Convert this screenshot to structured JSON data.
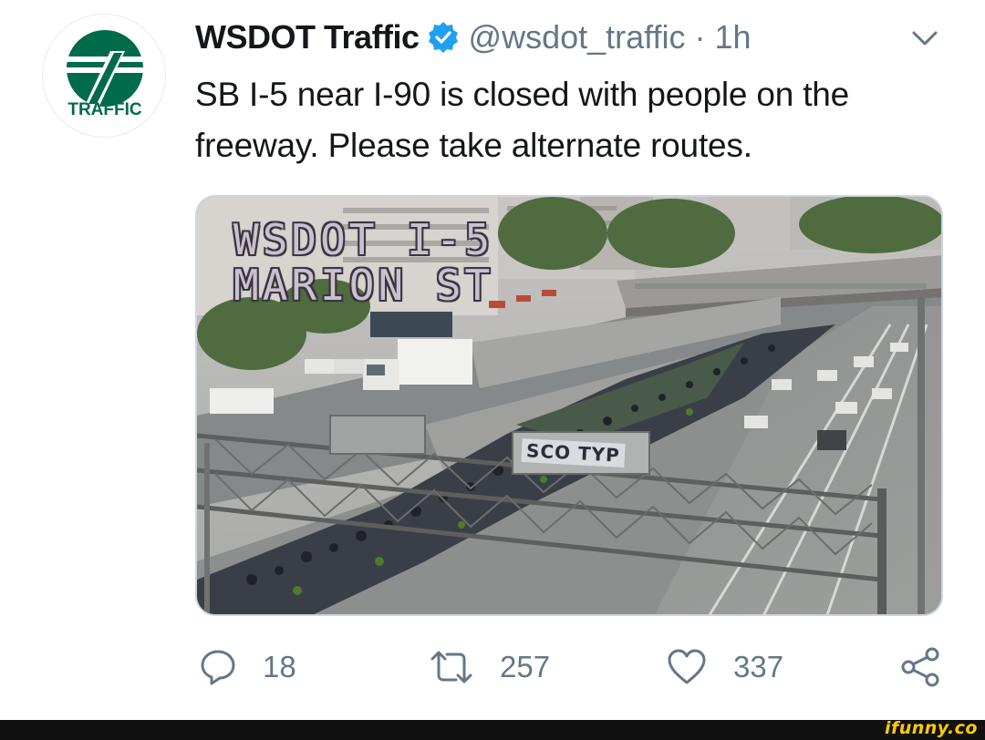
{
  "tweet": {
    "avatar_label": "TRAFFIC",
    "display_name": "WSDOT Traffic",
    "handle": "@wsdot_traffic",
    "separator": "·",
    "time": "1h",
    "text": "SB I-5 near I-90 is closed with people on the freeway. Please take alternate routes."
  },
  "media": {
    "camera_label_line1": "WSDOT I-5",
    "camera_label_line2": "MARION ST",
    "sign_text": "SCO TYP"
  },
  "actions": {
    "reply_count": "18",
    "retweet_count": "257",
    "like_count": "337"
  },
  "footer": {
    "watermark": "ifunny.co"
  },
  "colors": {
    "brand_green": "#006b4a",
    "verified_blue": "#1da1f2",
    "muted_text": "#657786"
  }
}
